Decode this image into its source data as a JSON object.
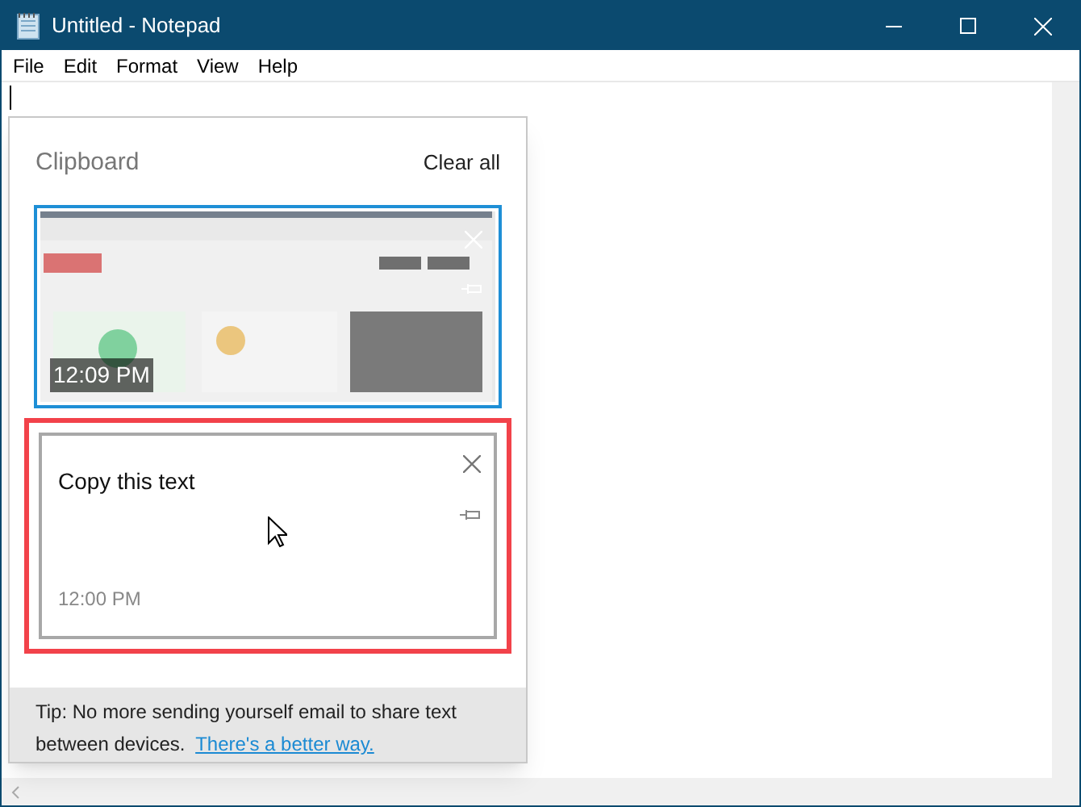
{
  "window": {
    "title": "Untitled - Notepad"
  },
  "menu": [
    "File",
    "Edit",
    "Format",
    "View",
    "Help"
  ],
  "clipboard": {
    "title": "Clipboard",
    "clear_all": "Clear all",
    "items": [
      {
        "kind": "image",
        "time": "12:09 PM",
        "selected": true,
        "highlighted": false
      },
      {
        "kind": "text",
        "text": "Copy this text",
        "time": "12:00 PM",
        "selected": false,
        "highlighted": true
      }
    ],
    "tip": "Tip: No more sending yourself email to share text between devices.",
    "tip_link": "There's a better way."
  }
}
